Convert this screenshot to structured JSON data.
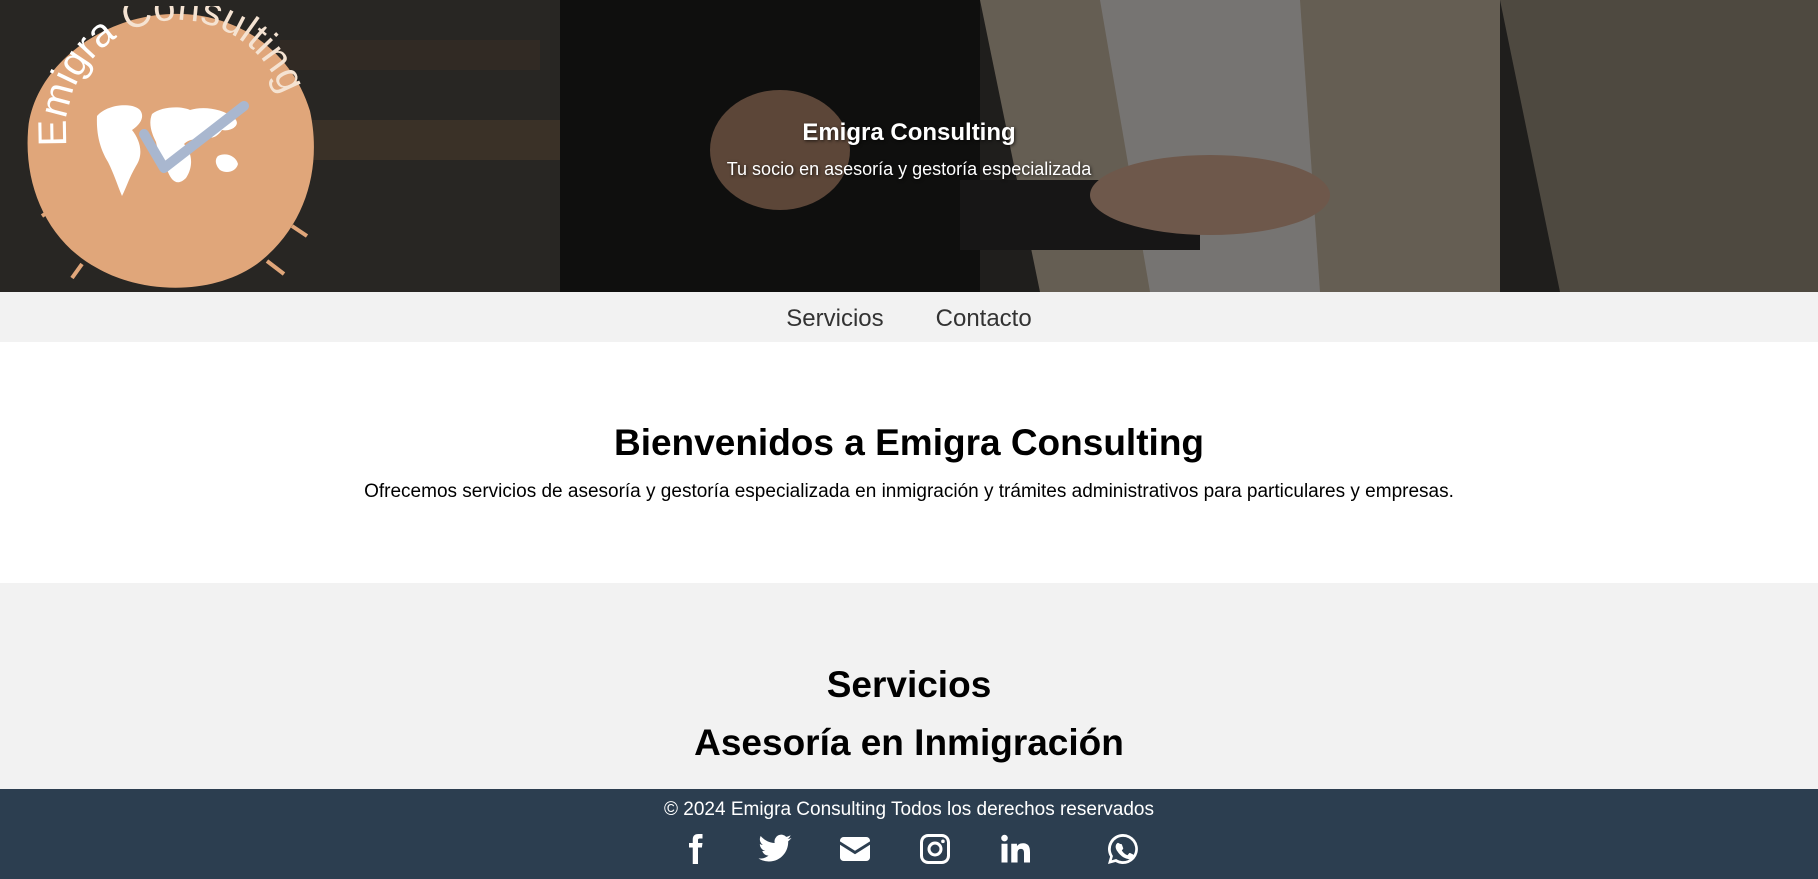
{
  "hero": {
    "title": "Emigra Consulting",
    "subtitle": "Tu socio en asesoría y gestoría especializada",
    "logo": {
      "text": "Emigra Consulting",
      "icon": "world-map-check-icon",
      "color": "#e0a67a"
    }
  },
  "nav": {
    "items": [
      {
        "label": "Servicios"
      },
      {
        "label": "Contacto"
      }
    ]
  },
  "welcome": {
    "title": "Bienvenidos a Emigra Consulting",
    "text": "Ofrecemos servicios de asesoría y gestoría especializada en inmigración y trámites administrativos para particulares y empresas."
  },
  "services": {
    "title": "Servicios",
    "first_service": "Asesoría en Inmigración"
  },
  "footer": {
    "copyright": "© 2024 Emigra Consulting Todos los derechos reservados",
    "background": "#2c3e50",
    "socials": [
      {
        "icon": "facebook-icon"
      },
      {
        "icon": "twitter-icon"
      },
      {
        "icon": "envelope-icon"
      },
      {
        "icon": "instagram-icon"
      },
      {
        "icon": "linkedin-icon"
      },
      {
        "icon": "whatsapp-icon"
      }
    ]
  }
}
